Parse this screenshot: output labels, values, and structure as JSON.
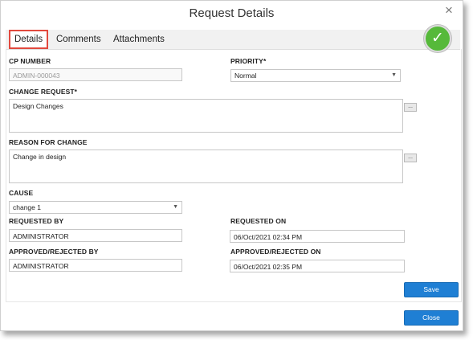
{
  "dialog": {
    "title": "Request Details",
    "close_glyph": "×"
  },
  "tabs": [
    {
      "label": "Details",
      "active": true
    },
    {
      "label": "Comments",
      "active": false
    },
    {
      "label": "Attachments",
      "active": false
    }
  ],
  "status_icon": {
    "name": "check-circle-icon",
    "glyph": "✓",
    "color": "#56b93a"
  },
  "form": {
    "cp_number": {
      "label": "CP NUMBER",
      "value": "ADMIN-000043"
    },
    "priority": {
      "label": "PRIORITY*",
      "value": "Normal"
    },
    "change_request": {
      "label": "CHANGE REQUEST*",
      "value": "Design Changes",
      "more": "..."
    },
    "reason_for_change": {
      "label": "REASON FOR CHANGE",
      "value": "Change in design",
      "more": "..."
    },
    "cause": {
      "label": "CAUSE",
      "value": "change 1"
    },
    "requested_by": {
      "label": "REQUESTED BY",
      "value": "ADMINISTRATOR"
    },
    "requested_on": {
      "label": "REQUESTED ON",
      "value": "06/Oct/2021 02:34 PM"
    },
    "approved_by": {
      "label": "APPROVED/REJECTED BY",
      "value": "ADMINISTRATOR"
    },
    "approved_on": {
      "label": "APPROVED/REJECTED ON",
      "value": "06/Oct/2021 02:35 PM"
    }
  },
  "buttons": {
    "save": "Save",
    "close": "Close"
  },
  "colors": {
    "primary": "#1f7fd4",
    "active_tab_border": "#e2493e"
  }
}
